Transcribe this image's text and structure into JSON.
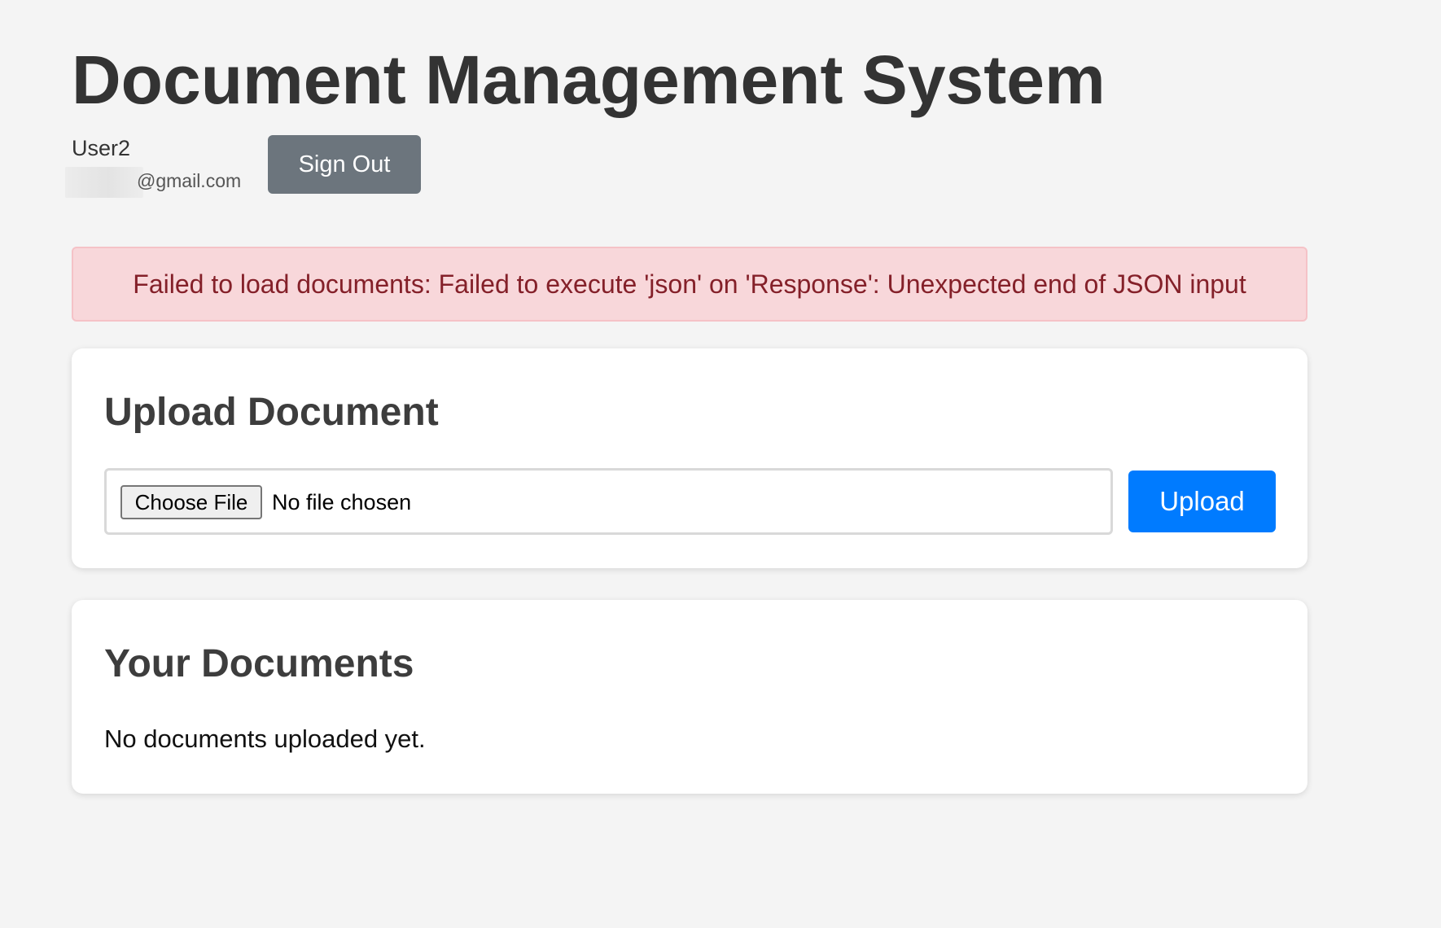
{
  "header": {
    "title": "Document Management System"
  },
  "user": {
    "name": "User2",
    "email_visible": "@gmail.com",
    "sign_out_label": "Sign Out"
  },
  "error": {
    "message": "Failed to load documents: Failed to execute 'json' on 'Response': Unexpected end of JSON input"
  },
  "upload": {
    "title": "Upload Document",
    "choose_file_label": "Choose File",
    "file_status": "No file chosen",
    "upload_label": "Upload"
  },
  "documents": {
    "title": "Your Documents",
    "empty_message": "No documents uploaded yet."
  },
  "colors": {
    "background": "#f4f4f4",
    "primary": "#007bff",
    "secondary": "#6c757d",
    "error_background": "#f8d7da",
    "error_text": "#842029"
  }
}
